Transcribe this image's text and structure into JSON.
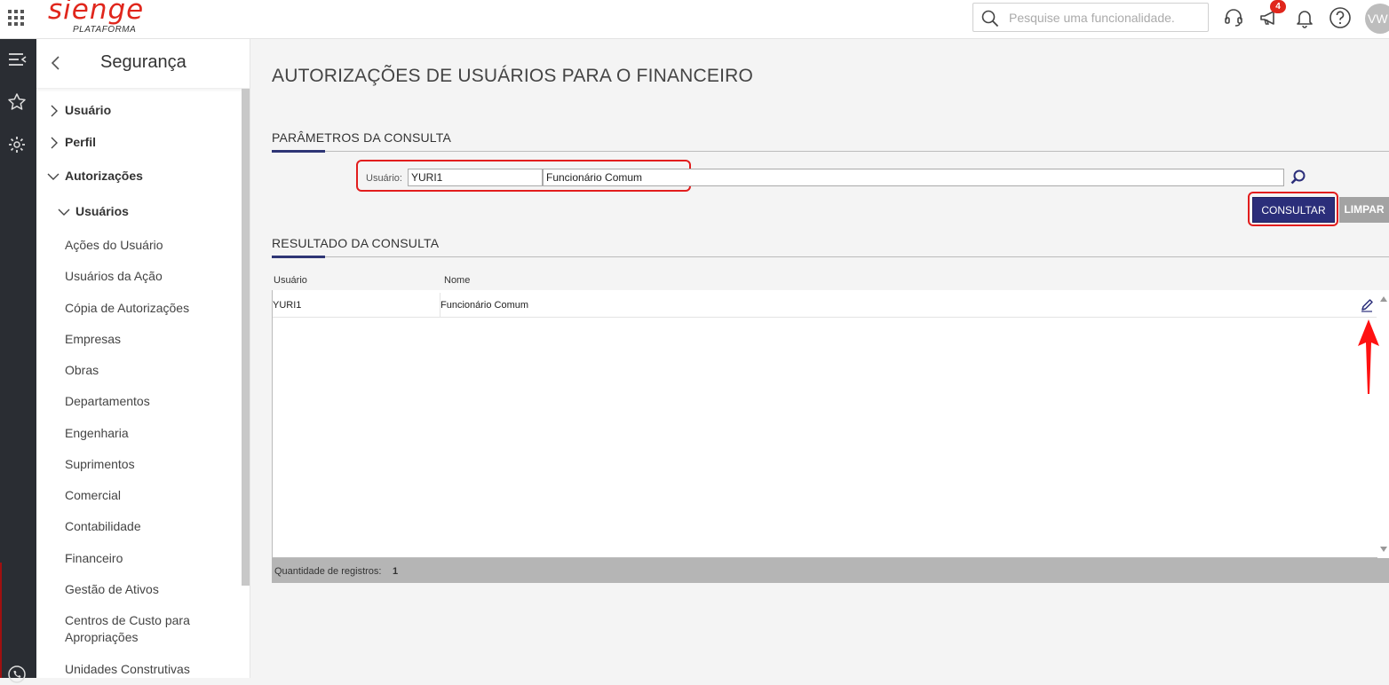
{
  "header": {
    "logo_text": "sienge",
    "logo_sub": "PLATAFORMA",
    "search_placeholder": "Pesquise uma funcionalidade.",
    "notification_count": "4",
    "avatar_initials": "VW"
  },
  "sidebar": {
    "title": "Segurança",
    "items": [
      {
        "label": "Usuário"
      },
      {
        "label": "Perfil"
      },
      {
        "label": "Autorizações"
      },
      {
        "label": "Usuários"
      }
    ],
    "subitems": [
      "Ações do Usuário",
      "Usuários da Ação",
      "Cópia de Autorizações",
      "Empresas",
      "Obras",
      "Departamentos",
      "Engenharia",
      "Suprimentos",
      "Comercial",
      "Contabilidade",
      "Financeiro",
      "Gestão de Ativos",
      "Centros de Custo para Apropriações",
      "Unidades Construtivas"
    ]
  },
  "main": {
    "page_title": "AUTORIZAÇÕES DE USUÁRIOS PARA O FINANCEIRO",
    "params_title": "PARÂMETROS DA CONSULTA",
    "user_label": "Usuário:",
    "user_code": "YURI1",
    "user_name": "Funcionário Comum",
    "consult_button": "CONSULTAR",
    "clear_button": "LIMPAR",
    "results_title": "RESULTADO DA CONSULTA",
    "columns": {
      "user": "Usuário",
      "name": "Nome"
    },
    "rows": [
      {
        "user": "YURI1",
        "name": "Funcionário Comum"
      }
    ],
    "footer_label": "Quantidade de registros:",
    "footer_count": "1"
  },
  "colors": {
    "brand": "#e0261c",
    "primary_button": "#2b2e7a",
    "rail": "#2a2d33",
    "highlight": "#e21d1d"
  }
}
